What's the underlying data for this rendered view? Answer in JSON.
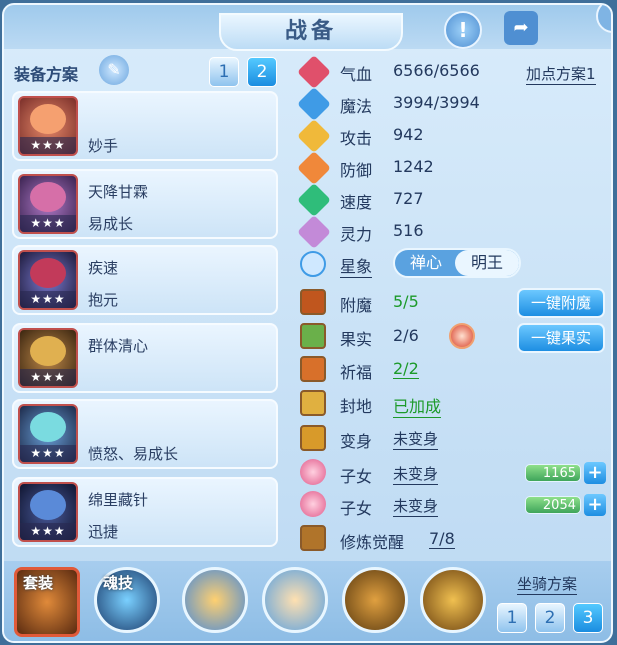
{
  "title": "战备",
  "equipment_label": "装备方案",
  "scheme_buttons": [
    "1",
    "2"
  ],
  "equipment": [
    {
      "line1": "",
      "line2": "妙手",
      "stars": "★★★"
    },
    {
      "line1": "天降甘霖",
      "line2": "易成长",
      "stars": "★★★"
    },
    {
      "line1": "疾速",
      "line2": "抱元",
      "stars": "★★★"
    },
    {
      "line1": "群体清心",
      "line2": "",
      "stars": "★★★"
    },
    {
      "line1": "",
      "line2": "愤怒、易成长",
      "stars": "★★★"
    },
    {
      "line1": "绵里藏针",
      "line2": "迅捷",
      "stars": "★★★"
    }
  ],
  "stats": [
    {
      "label": "气血",
      "value": "6566/6566",
      "color": "#e0506b"
    },
    {
      "label": "魔法",
      "value": "3994/3994",
      "color": "#3f9be6"
    },
    {
      "label": "攻击",
      "value": "942",
      "color": "#f0b93a"
    },
    {
      "label": "防御",
      "value": "1242",
      "color": "#f0883a"
    },
    {
      "label": "速度",
      "value": "727",
      "color": "#2fbd7a"
    },
    {
      "label": "灵力",
      "value": "516",
      "color": "#c38ad8"
    }
  ],
  "point_scheme": "加点方案1",
  "star_label": "星象",
  "star_options": [
    "禅心",
    "明王"
  ],
  "enchant": {
    "label": "附魔",
    "value": "5/5"
  },
  "fruit": {
    "label": "果实",
    "value": "2/6"
  },
  "bless": {
    "label": "祈福",
    "value": "2/2"
  },
  "seal": {
    "label": "封地",
    "value": "已加成"
  },
  "transform": {
    "label": "变身",
    "value": "未变身"
  },
  "child1": {
    "label": "子女",
    "value": "未变身",
    "bar": "1165"
  },
  "child2": {
    "label": "子女",
    "value": "未变身",
    "bar": "2054"
  },
  "awaken": {
    "label": "修炼觉醒",
    "value": "7/8"
  },
  "btn_enchant": "一键附魔",
  "btn_fruit": "一键果实",
  "bottom": {
    "suit": "套装",
    "soul": "魂技",
    "mount_label": "坐骑方案",
    "mount_buttons": [
      "1",
      "2",
      "3"
    ]
  },
  "colors": {
    "green": "#1c9a2a",
    "accent": "#1d8ee2"
  }
}
